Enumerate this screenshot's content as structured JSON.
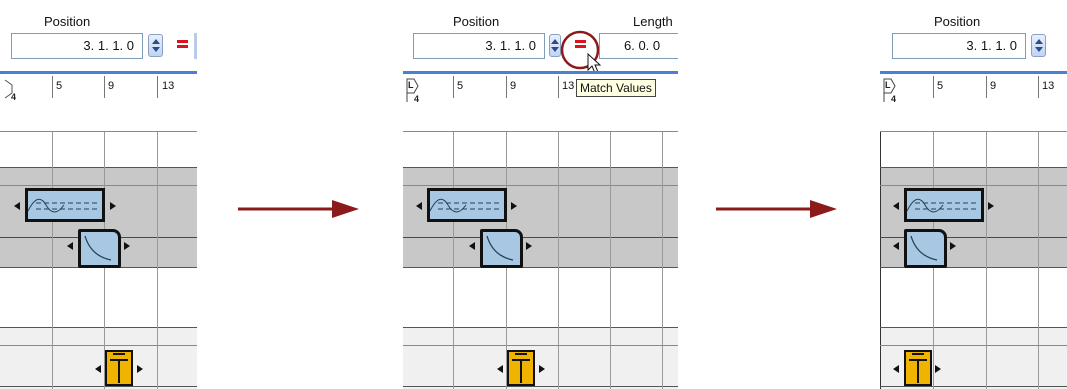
{
  "panels": [
    {
      "position_label": "Position",
      "position_value": "3.  1.  1.    0",
      "length_label": "",
      "length_value": "",
      "ruler_ticks": [
        "5",
        "9",
        "13"
      ],
      "marker_flag": "",
      "marker_sub": "4"
    },
    {
      "position_label": "Position",
      "position_value": "3.  1.  1.    0",
      "length_label": "Length",
      "length_value": "6.  0.  0",
      "ruler_ticks": [
        "5",
        "9",
        "13"
      ],
      "marker_flag": "L",
      "marker_sub": "4",
      "tooltip": "Match Values"
    },
    {
      "position_label": "Position",
      "position_value": "3.  1.  1.    0",
      "length_label": "",
      "length_value": "",
      "ruler_ticks": [
        "5",
        "9",
        "13"
      ],
      "marker_flag": "L",
      "marker_sub": "4"
    }
  ],
  "colors": {
    "accent_ruler": "#4a7fd4",
    "lane_gray": "#c8c8c8",
    "region_fill": "#a7c7e3",
    "arrow_color": "#8b1a1a",
    "match_button": "#d9141e",
    "highlight_circle": "#8b1a1a",
    "event_yellow": "#f0b400"
  },
  "icons": [
    "spin-arrows-icon",
    "match-values-icon",
    "mouse-cursor-icon",
    "right-arrow-icon",
    "left-locator-icon",
    "automation-curve-icon",
    "event-icon"
  ]
}
